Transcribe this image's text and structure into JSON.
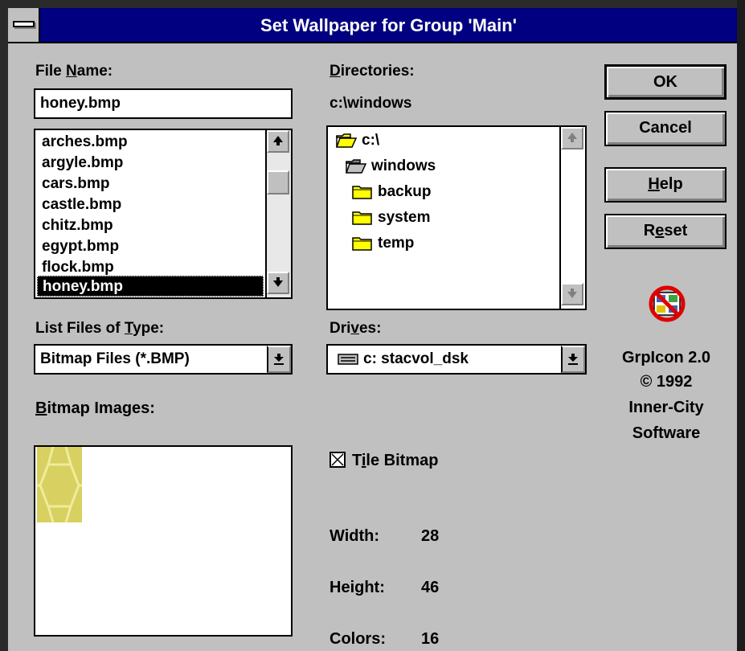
{
  "window": {
    "title": "Set Wallpaper for Group 'Main'"
  },
  "file_name": {
    "label_pre": "File ",
    "label_u": "N",
    "label_post": "ame:",
    "value": "honey.bmp",
    "files": [
      "arches.bmp",
      "argyle.bmp",
      "cars.bmp",
      "castle.bmp",
      "chitz.bmp",
      "egypt.bmp",
      "flock.bmp",
      "honey.bmp"
    ],
    "selected": "honey.bmp"
  },
  "file_type": {
    "label_pre": "List Files of ",
    "label_u": "T",
    "label_post": "ype:",
    "value": "Bitmap Files (*.BMP)"
  },
  "bitmap_images": {
    "label_u": "B",
    "label_post": "itmap Images:"
  },
  "directories": {
    "label_u": "D",
    "label_post": "irectories:",
    "current_path": "c:\\windows",
    "items": [
      {
        "name": "c:\\",
        "icon": "open-folder-icon"
      },
      {
        "name": "windows",
        "icon": "open-folder-icon"
      },
      {
        "name": "backup",
        "icon": "folder-icon"
      },
      {
        "name": "system",
        "icon": "folder-icon"
      },
      {
        "name": "temp",
        "icon": "folder-icon"
      }
    ]
  },
  "drives": {
    "label_pre": "Dri",
    "label_u": "v",
    "label_post": "es:",
    "value": "c: stacvol_dsk",
    "icon": "drive-icon"
  },
  "tile": {
    "label_pre": "T",
    "label_u": "i",
    "label_post": "le Bitmap",
    "checked": true
  },
  "info": {
    "width_label": "Width:",
    "width_value": "28",
    "height_label": "Height:",
    "height_value": "46",
    "colors_label": "Colors:",
    "colors_value": "16"
  },
  "buttons": {
    "ok": "OK",
    "cancel": "Cancel",
    "help_u": "H",
    "help_post": "elp",
    "reset_pre": "R",
    "reset_u": "e",
    "reset_post": "set"
  },
  "about": {
    "line1": "GrpIcon 2.0",
    "line2": "© 1992",
    "line3": "Inner-City",
    "line4": "Software",
    "icon": "no-icons-logo-icon"
  },
  "colors": {
    "title_bar": "#000080",
    "face": "#c0c0c0",
    "selection": "#000000",
    "folder": "#ffff00",
    "honeycomb": "#d8d060"
  }
}
